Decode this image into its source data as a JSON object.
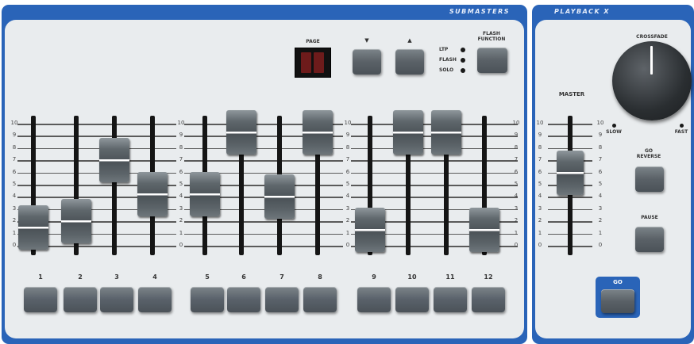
{
  "submasters": {
    "title": "SUBMASTERS",
    "page_label": "PAGE",
    "up_label": "▼",
    "down_label": "▲",
    "mode_labels": [
      "LTP",
      "FLASH",
      "SOLO"
    ],
    "flash_function_label": "FLASH FUNCTION",
    "scale_left": [
      "10",
      "9",
      "8",
      "7",
      "6",
      "5",
      "4",
      "3",
      "2",
      "1",
      "0"
    ],
    "scale_mid": [
      "10",
      "9",
      "8",
      "7",
      "6",
      "5",
      "4",
      "3",
      "2",
      "1",
      "0"
    ],
    "scale_mid2": [
      "10",
      "9",
      "8",
      "7",
      "6",
      "5",
      "4",
      "3",
      "2",
      "1",
      "0"
    ],
    "scale_right": [
      "10",
      "9",
      "8",
      "7",
      "6",
      "5",
      "4",
      "3",
      "2",
      "1",
      "0"
    ],
    "channel_labels": [
      "1",
      "2",
      "3",
      "4",
      "5",
      "6",
      "7",
      "8",
      "9",
      "10",
      "11",
      "12"
    ],
    "fader_levels": [
      0.15,
      0.2,
      0.7,
      0.42,
      0.42,
      0.93,
      0.4,
      0.93,
      0.13,
      0.93,
      0.93,
      0.13
    ]
  },
  "playback": {
    "title": "PLAYBACK X",
    "crossfade_label": "CROSSFADE",
    "slow_label": "SLOW",
    "fast_label": "FAST",
    "master_label": "MASTER",
    "master_scale": [
      "10",
      "9",
      "8",
      "7",
      "6",
      "5",
      "4",
      "3",
      "2",
      "1",
      "0"
    ],
    "master_level": 0.6,
    "go_reverse_label": "GO REVERSE",
    "pause_label": "PAUSE",
    "go_label": "GO"
  }
}
